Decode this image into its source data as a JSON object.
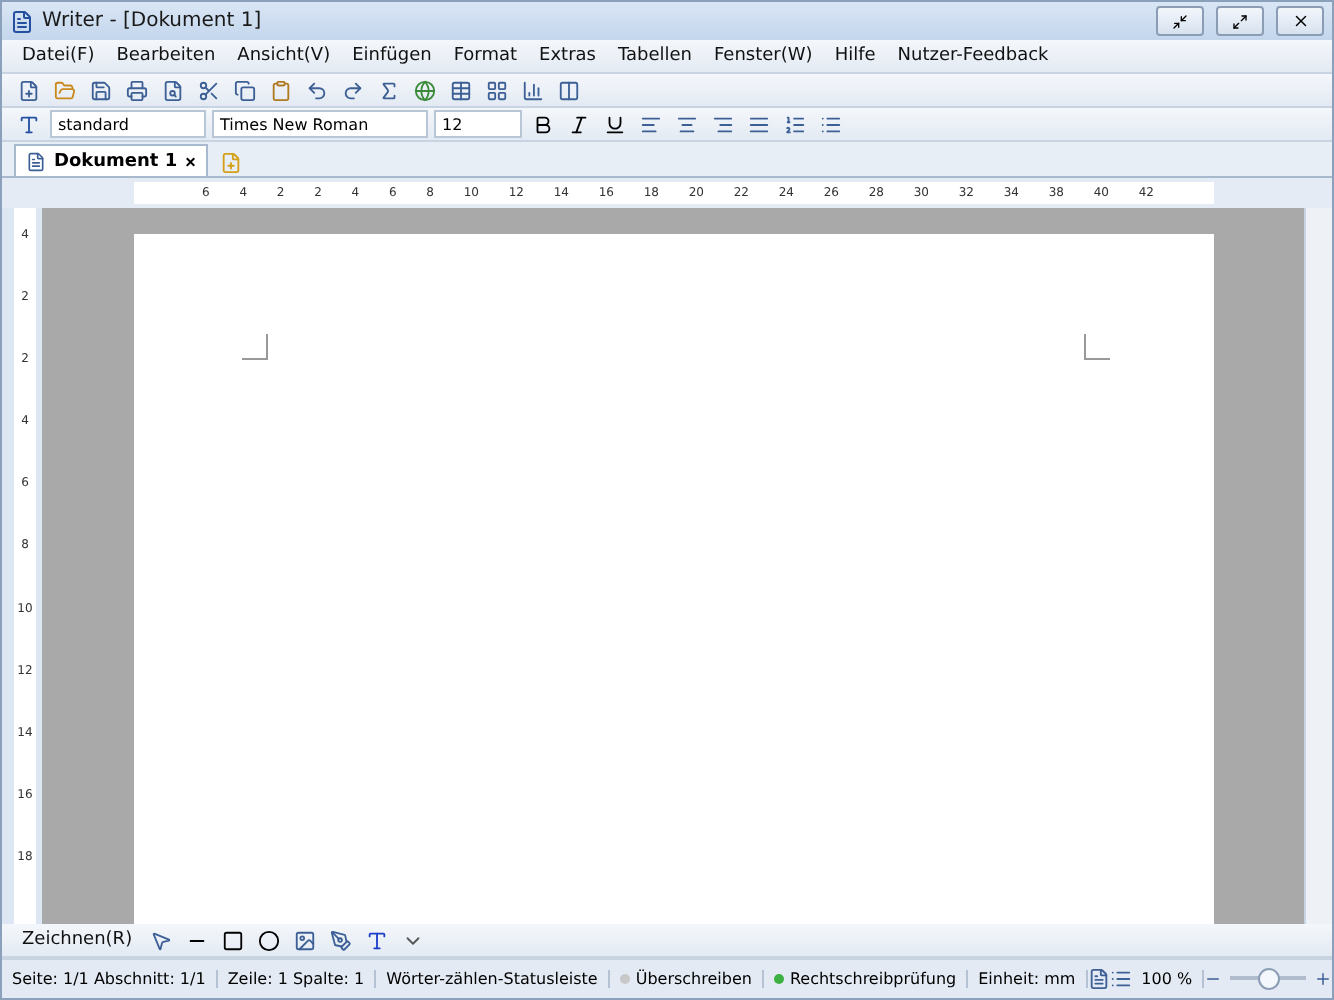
{
  "window": {
    "title": "Writer - [Dokument 1]"
  },
  "menu": [
    "Datei(F)",
    "Bearbeiten",
    "Ansicht(V)",
    "Einfügen",
    "Format",
    "Extras",
    "Tabellen",
    "Fenster(W)",
    "Hilfe",
    "Nutzer-Feedback"
  ],
  "format_bar": {
    "style": "standard",
    "font": "Times New Roman",
    "size": "12"
  },
  "tabs": [
    {
      "label": "Dokument 1",
      "selected": true,
      "close": "×"
    }
  ],
  "ruler": {
    "horizontal": [
      "6",
      "4",
      "2",
      "2",
      "4",
      "6",
      "8",
      "10",
      "12",
      "14",
      "16",
      "18",
      "20",
      "22",
      "24",
      "26",
      "28",
      "30",
      "32",
      "34",
      "38",
      "40",
      "42"
    ],
    "vertical": [
      "4",
      "2",
      "2",
      "4",
      "6",
      "8",
      "10",
      "12",
      "14",
      "16",
      "18"
    ]
  },
  "drawing_bar": {
    "label": "Zeichnen(R)"
  },
  "status_bar": {
    "cells": [
      "Seite: 1/1 Abschnitt: 1/1",
      "Zeile: 1 Spalte: 1",
      "Wörter-zählen-Statusleiste"
    ],
    "indicators": [
      {
        "label": "Überschreiben",
        "on": false
      },
      {
        "label": "Rechtschreibprüfung",
        "on": true
      }
    ],
    "unit": "Einheit: mm",
    "zoom": "100 %",
    "zoom_level": {
      "level": 0.5
    }
  }
}
